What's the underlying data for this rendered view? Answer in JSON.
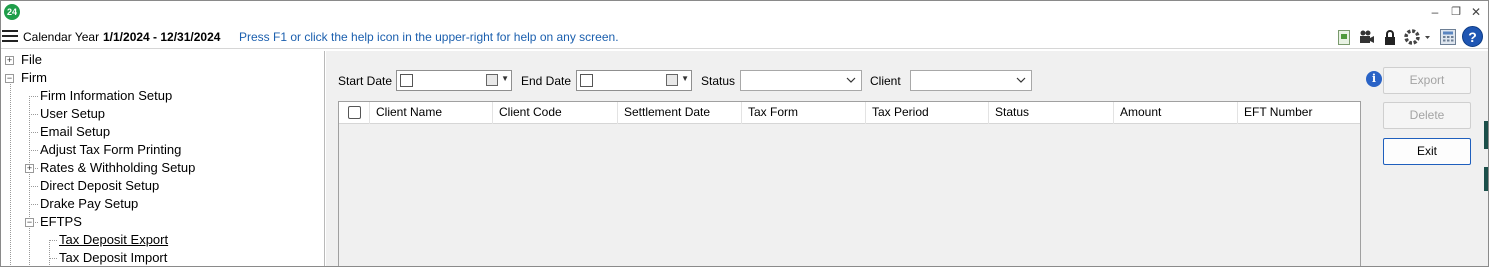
{
  "app": {
    "logo_text": "24",
    "window_controls": {
      "minimize": "–",
      "restore": "❐",
      "close": "✕"
    }
  },
  "header": {
    "calendar_label": "Calendar Year",
    "calendar_range": "1/1/2024 - 12/31/2024",
    "help_text": "Press F1 or click the help icon in the upper-right for help on any screen.",
    "icons": [
      "document-icon",
      "video-icon",
      "lock-icon",
      "gear-icon",
      "calculator-icon",
      "help-icon"
    ],
    "help_glyph": "?"
  },
  "tree": {
    "expand_glyph": "+",
    "collapse_glyph": "−",
    "file": "File",
    "firm": "Firm",
    "items": {
      "firm_information_setup": "Firm Information Setup",
      "user_setup": "User Setup",
      "email_setup": "Email Setup",
      "adjust_tax_form_printing": "Adjust Tax Form Printing",
      "rates_withholding_setup": "Rates & Withholding Setup",
      "direct_deposit_setup": "Direct Deposit Setup",
      "drake_pay_setup": "Drake Pay Setup",
      "eftps": "EFTPS"
    },
    "eftps_children": {
      "tax_deposit_export": "Tax Deposit Export",
      "tax_deposit_import": "Tax Deposit Import"
    }
  },
  "filters": {
    "start_date_label": "Start Date",
    "start_date_value": "",
    "end_date_label": "End Date",
    "end_date_value": "",
    "status_label": "Status",
    "status_value": "",
    "client_label": "Client",
    "client_value": ""
  },
  "grid": {
    "columns": [
      "Client Name",
      "Client Code",
      "Settlement Date",
      "Tax Form",
      "Tax Period",
      "Status",
      "Amount",
      "EFT Number"
    ],
    "rows": []
  },
  "actions": {
    "info_glyph": "i",
    "export": "Export",
    "delete": "Delete",
    "exit": "Exit"
  },
  "colors": {
    "accent_green": "#1f9e4a",
    "help_blue": "#1b5fae",
    "exit_border": "#1f5fbd"
  }
}
